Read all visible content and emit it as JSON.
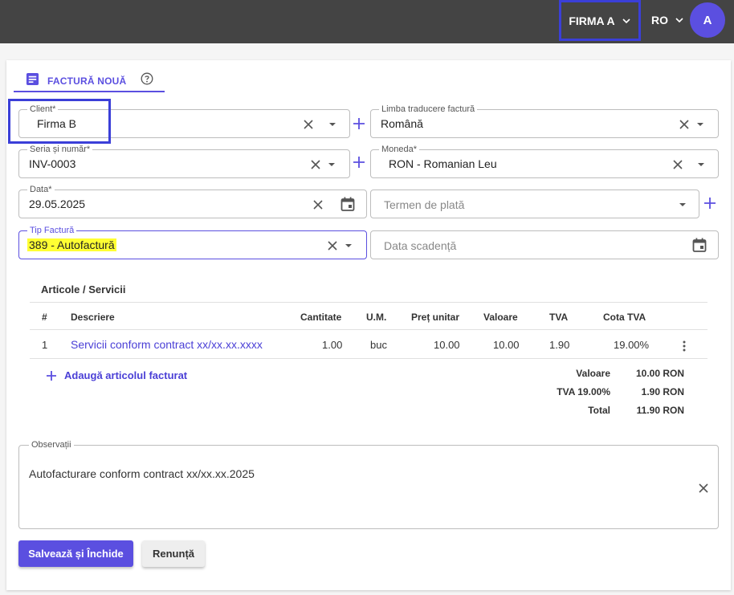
{
  "topbar": {
    "company": "FIRMA A",
    "language": "RO",
    "avatar_initial": "A"
  },
  "tab": {
    "label": "FACTURĂ NOUĂ"
  },
  "fields": {
    "client": {
      "label": "Client*",
      "value": "Firma B"
    },
    "translation_language": {
      "label": "Limba traducere factură",
      "value": "Română"
    },
    "series_number": {
      "label": "Seria și număr*",
      "value": "INV-0003"
    },
    "currency": {
      "label": "Moneda*",
      "value": "RON - Romanian Leu"
    },
    "date": {
      "label": "Data*",
      "value": "29.05.2025"
    },
    "payment_term": {
      "placeholder": "Termen de plată"
    },
    "invoice_type": {
      "label": "Tip Factură",
      "value": "389 - Autofactură"
    },
    "due_date": {
      "placeholder": "Data scadență"
    }
  },
  "articles": {
    "title": "Articole / Servicii",
    "headers": {
      "nr": "#",
      "description": "Descriere",
      "quantity": "Cantitate",
      "um": "U.M.",
      "unit_price": "Preț unitar",
      "value": "Valoare",
      "vat": "TVA",
      "vat_rate": "Cota TVA"
    },
    "rows": [
      {
        "nr": "1",
        "description": "Servicii conform contract xx/xx.xx.xxxx",
        "quantity": "1.00",
        "um": "buc",
        "unit_price": "10.00",
        "value": "10.00",
        "vat": "1.90",
        "vat_rate": "19.00%"
      }
    ],
    "add_label": "Adaugă articolul facturat"
  },
  "totals": {
    "value_label": "Valoare",
    "value": "10.00 RON",
    "vat_label": "TVA 19.00%",
    "vat": "1.90 RON",
    "total_label": "Total",
    "total": "11.90 RON"
  },
  "notes": {
    "label": "Observații",
    "value": "Autofacturare conform contract xx/xx.xx.2025"
  },
  "buttons": {
    "save": "Salvează și Închide",
    "cancel": "Renunță"
  },
  "colors": {
    "accent": "#5b4fe0",
    "topbar": "#444444",
    "highlight": "#ffff33",
    "annotation_box": "#3b3fd8"
  }
}
